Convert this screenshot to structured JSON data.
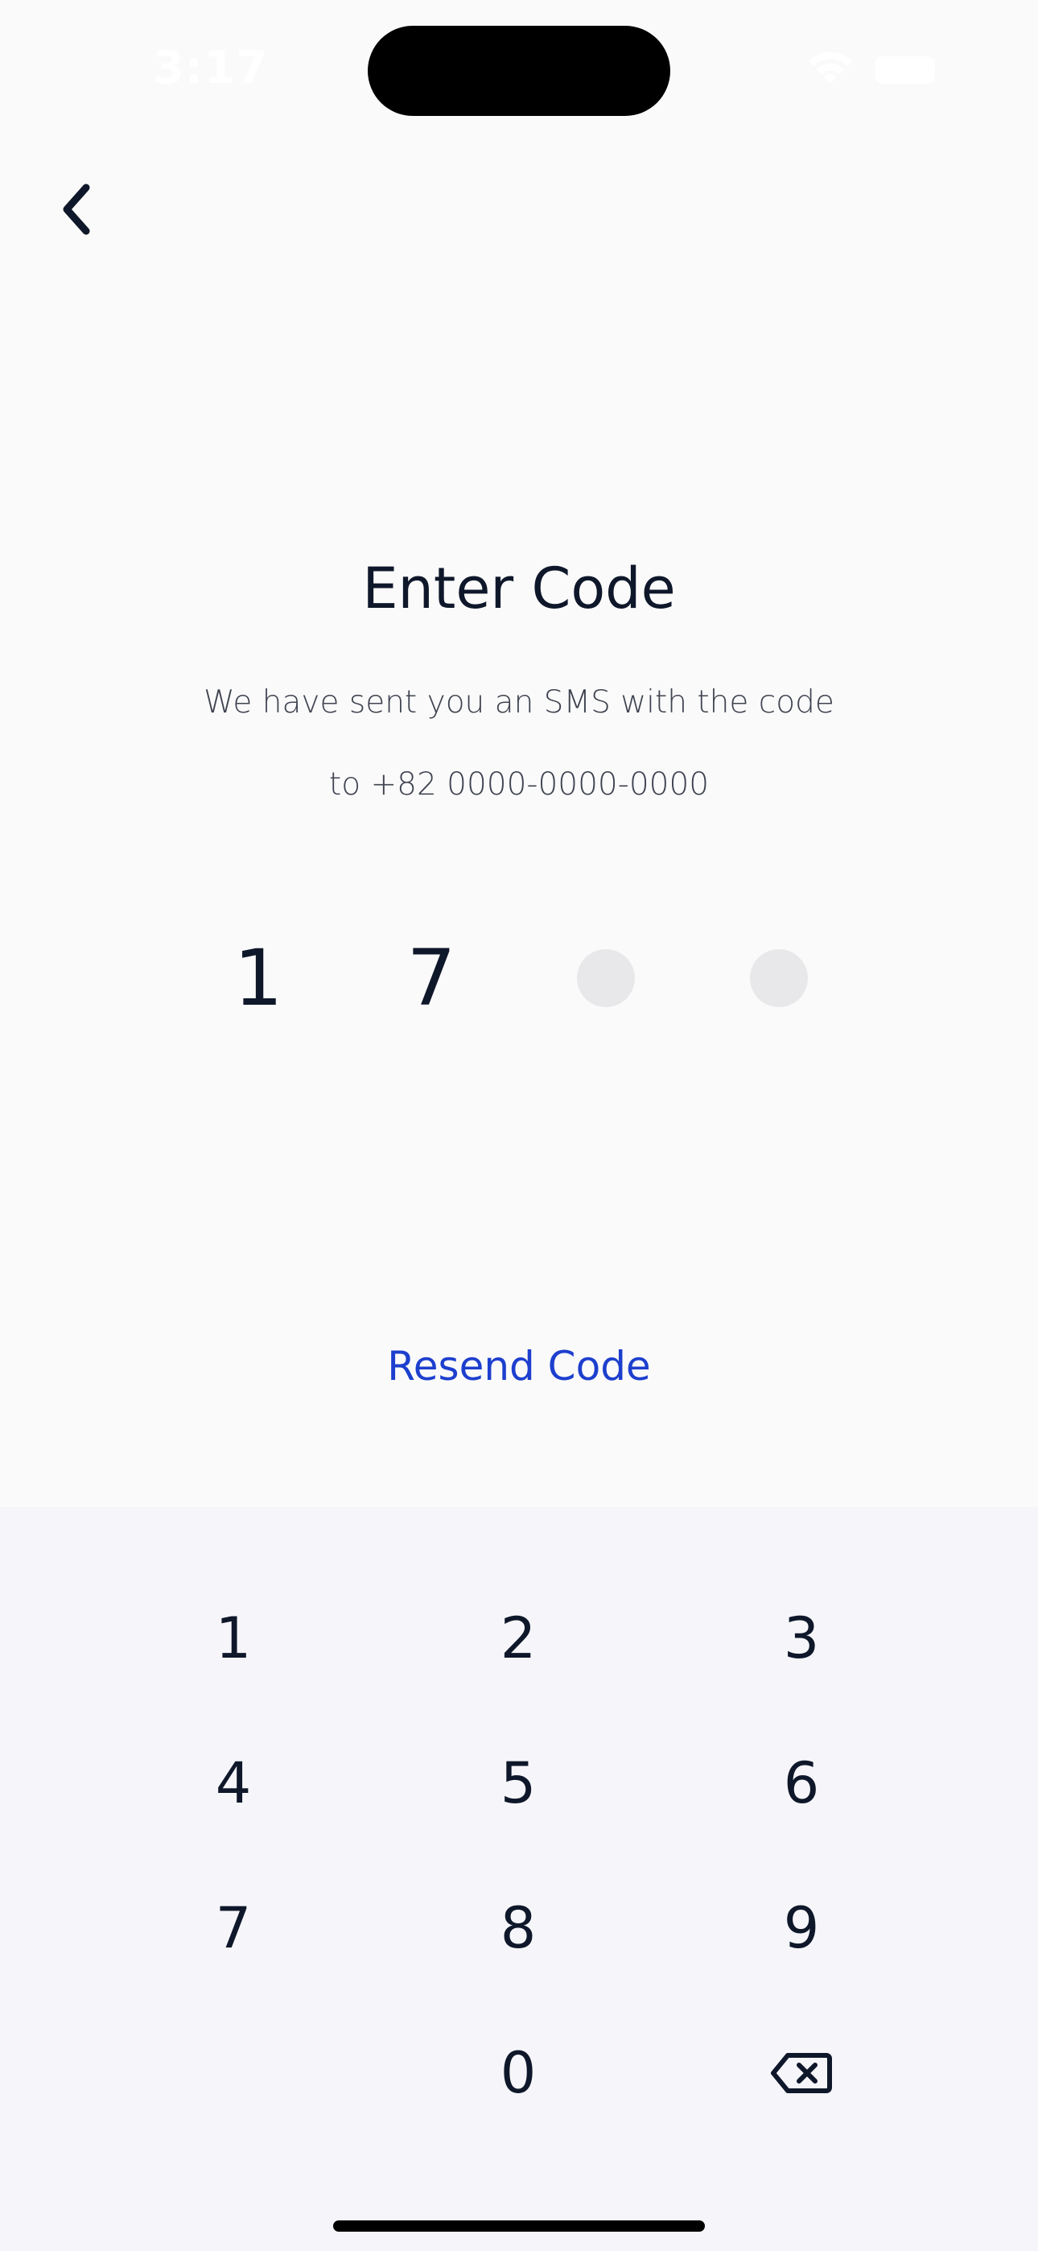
{
  "status_bar": {
    "time": "3:17"
  },
  "header": {
    "back_icon": "chevron-left-icon"
  },
  "main": {
    "title": "Enter Code",
    "subtitle_line1": "We have sent you an SMS with the code",
    "subtitle_line2": "to +82 0000-0000-0000",
    "code": {
      "length": 4,
      "entered": [
        "1",
        "7",
        "",
        ""
      ]
    },
    "resend_label": "Resend Code"
  },
  "keypad": {
    "keys": [
      "1",
      "2",
      "3",
      "4",
      "5",
      "6",
      "7",
      "8",
      "9",
      "0"
    ],
    "delete_icon": "backspace-icon"
  },
  "colors": {
    "background": "#fafafa",
    "keypad_background": "#f6f6fa",
    "text": "#0f172a",
    "link": "#1d3fce",
    "empty_slot": "#e8e8ea"
  }
}
